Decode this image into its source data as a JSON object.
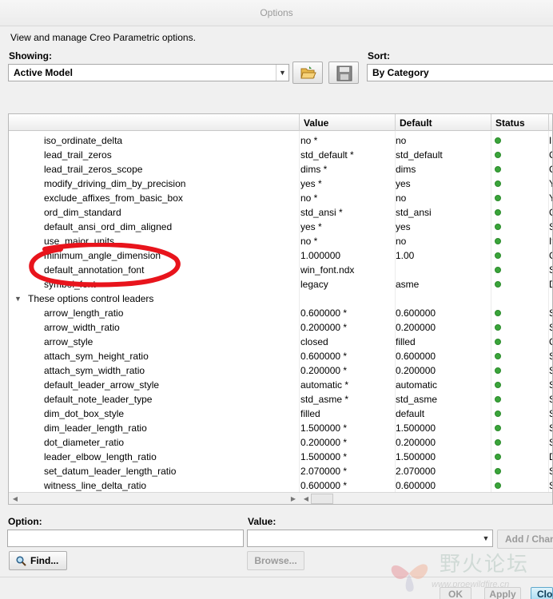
{
  "window": {
    "title": "Options"
  },
  "description": "View and manage Creo Parametric options.",
  "showing": {
    "label": "Showing:",
    "value": "Active Model"
  },
  "sort": {
    "label": "Sort:",
    "value": "By Category"
  },
  "table": {
    "columns": [
      "Value",
      "Default",
      "Status"
    ],
    "rows": [
      {
        "name": "iso_ordinate_delta",
        "value": "no *",
        "default": "no",
        "extra": "In"
      },
      {
        "name": "lead_trail_zeros",
        "value": "std_default *",
        "default": "std_default",
        "extra": "C"
      },
      {
        "name": "lead_trail_zeros_scope",
        "value": "dims *",
        "default": "dims",
        "extra": "C"
      },
      {
        "name": "modify_driving_dim_by_precision",
        "value": "yes *",
        "default": "yes",
        "extra": "Y"
      },
      {
        "name": "exclude_affixes_from_basic_box",
        "value": "no *",
        "default": "no",
        "extra": "Y"
      },
      {
        "name": "ord_dim_standard",
        "value": "std_ansi *",
        "default": "std_ansi",
        "extra": "C"
      },
      {
        "name": "default_ansi_ord_dim_aligned",
        "value": "yes *",
        "default": "yes",
        "extra": "S"
      },
      {
        "name": "use_major_units",
        "value": "no *",
        "default": "no",
        "extra": "If"
      },
      {
        "name": "minimum_angle_dimension",
        "value": "1.000000",
        "default": "1.00",
        "extra": "C"
      },
      {
        "name": "default_annotation_font",
        "value": "win_font.ndx",
        "default": "",
        "extra": "S"
      },
      {
        "name": "symbol_font",
        "value": "legacy",
        "default": "asme",
        "extra": "D"
      },
      {
        "name": "These options control leaders",
        "group": true
      },
      {
        "name": "arrow_length_ratio",
        "value": "0.600000 *",
        "default": "0.600000",
        "extra": "S"
      },
      {
        "name": "arrow_width_ratio",
        "value": "0.200000 *",
        "default": "0.200000",
        "extra": "S"
      },
      {
        "name": "arrow_style",
        "value": "closed",
        "default": "filled",
        "extra": "C"
      },
      {
        "name": "attach_sym_height_ratio",
        "value": "0.600000 *",
        "default": "0.600000",
        "extra": "S"
      },
      {
        "name": "attach_sym_width_ratio",
        "value": "0.200000 *",
        "default": "0.200000",
        "extra": "S"
      },
      {
        "name": "default_leader_arrow_style",
        "value": "automatic *",
        "default": "automatic",
        "extra": "S"
      },
      {
        "name": "default_note_leader_type",
        "value": "std_asme *",
        "default": "std_asme",
        "extra": "S"
      },
      {
        "name": "dim_dot_box_style",
        "value": "filled",
        "default": "default",
        "extra": "S"
      },
      {
        "name": "dim_leader_length_ratio",
        "value": "1.500000 *",
        "default": "1.500000",
        "extra": "S"
      },
      {
        "name": "dot_diameter_ratio",
        "value": "0.200000 *",
        "default": "0.200000",
        "extra": "S"
      },
      {
        "name": "leader_elbow_length_ratio",
        "value": "1.500000 *",
        "default": "1.500000",
        "extra": "D"
      },
      {
        "name": "set_datum_leader_length_ratio",
        "value": "2.070000 *",
        "default": "2.070000",
        "extra": "S"
      },
      {
        "name": "witness_line_delta_ratio",
        "value": "0.600000 *",
        "default": "0.600000",
        "extra": "S"
      }
    ]
  },
  "option": {
    "label": "Option:",
    "placeholder": ""
  },
  "valueField": {
    "label": "Value:"
  },
  "buttons": {
    "add_change": "Add / Change",
    "find": "Find...",
    "browse": "Browse...",
    "ok": "OK",
    "apply": "Apply",
    "close": "Close"
  },
  "watermark": {
    "text": "野火论坛",
    "url": "www.proewildfire.cn"
  },
  "colors": {
    "status_ok": "#3aa43a",
    "annotation": "#e8141c"
  }
}
